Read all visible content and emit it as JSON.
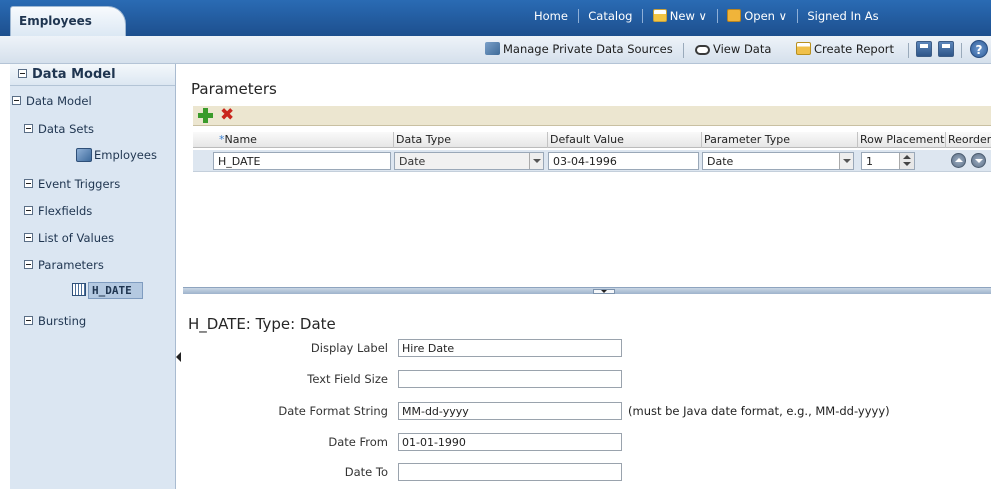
{
  "header": {
    "tab_label": "Employees",
    "nav": {
      "home": "Home",
      "catalog": "Catalog",
      "new": "New ∨",
      "open": "Open ∨",
      "signed_in": "Signed In As"
    }
  },
  "toolbar": {
    "manage_private": "Manage Private Data Sources",
    "view_data": "View Data",
    "create_report": "Create Report",
    "help": "?"
  },
  "sidebar": {
    "header": "Data Model",
    "root": "Data Model",
    "items": [
      {
        "label": "Data Sets"
      },
      {
        "label": "Employees"
      },
      {
        "label": "Event Triggers"
      },
      {
        "label": "Flexfields"
      },
      {
        "label": "List of Values"
      },
      {
        "label": "Parameters"
      },
      {
        "label": "H_DATE"
      },
      {
        "label": "Bursting"
      }
    ]
  },
  "parameters": {
    "title": "Parameters",
    "columns": {
      "required_mark": "*",
      "name": "Name",
      "data_type": "Data Type",
      "default_value": "Default Value",
      "parameter_type": "Parameter Type",
      "row_placement": "Row Placement",
      "reorder": "Reorder"
    },
    "rows": [
      {
        "name": "H_DATE",
        "data_type": "Date",
        "default_value": "03-04-1996",
        "parameter_type": "Date",
        "row_placement": "1"
      }
    ]
  },
  "detail": {
    "title": "H_DATE: Type: Date",
    "fields": [
      {
        "label": "Display Label",
        "value": ""
      },
      {
        "label": "Text Field Size",
        "value": ""
      },
      {
        "label": "Date Format String",
        "value": "MM-dd-yyyy",
        "hint": "(must be Java date format, e.g., MM-dd-yyyy)"
      },
      {
        "label": "Date From",
        "value": "01-01-1990"
      },
      {
        "label": "Date To",
        "value": ""
      }
    ],
    "display_label_value": "Hire Date"
  },
  "colors": {
    "header_blue": "#1d4f8e",
    "sidebar_bg": "#dbe6f2",
    "grid_toolbar": "#ece6d0",
    "add_green": "#3a9b2b",
    "delete_red": "#c9261d"
  },
  "icons": [
    "new-icon",
    "open-icon",
    "manage-private-data-sources-icon",
    "view-data-icon",
    "create-report-icon",
    "save-icon",
    "save-as-icon",
    "help-icon",
    "add-icon",
    "delete-icon",
    "dataset-icon",
    "parameter-icon"
  ]
}
